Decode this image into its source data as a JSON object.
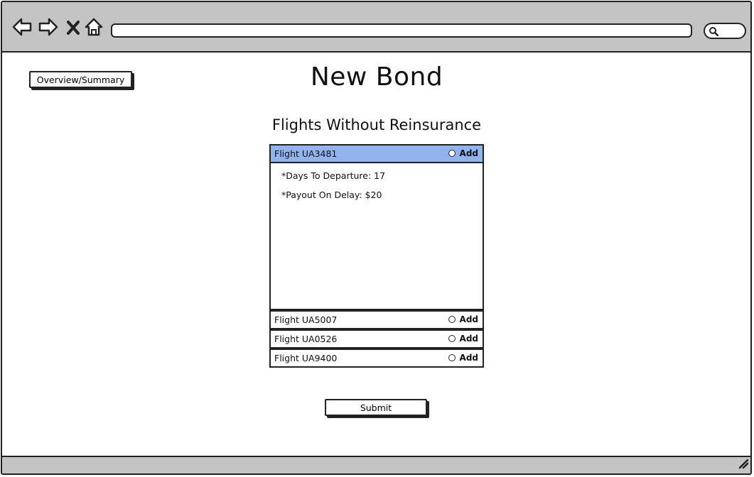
{
  "page": {
    "title": "New Bond",
    "section_title": "Flights Without Reinsurance",
    "overview_button": "Overview/Summary",
    "submit_button": "Submit"
  },
  "browser": {
    "icons": [
      "back-arrow-icon",
      "forward-arrow-icon",
      "close-icon",
      "home-icon",
      "search-icon",
      "resize-grip-icon"
    ],
    "url": ""
  },
  "flights": [
    {
      "name": "Flight UA3481",
      "add_label": "Add",
      "selected": true,
      "expanded": true,
      "details": [
        "*Days To Departure: 17",
        "*Payout On Delay: $20"
      ]
    },
    {
      "name": "Flight UA5007",
      "add_label": "Add",
      "selected": false,
      "expanded": false
    },
    {
      "name": "Flight UA0526",
      "add_label": "Add",
      "selected": false,
      "expanded": false
    },
    {
      "name": "Flight UA9400",
      "add_label": "Add",
      "selected": false,
      "expanded": false
    }
  ],
  "colors": {
    "chrome": "#c4c4c4",
    "selected_row": "#92b4ee",
    "border": "#222222"
  }
}
